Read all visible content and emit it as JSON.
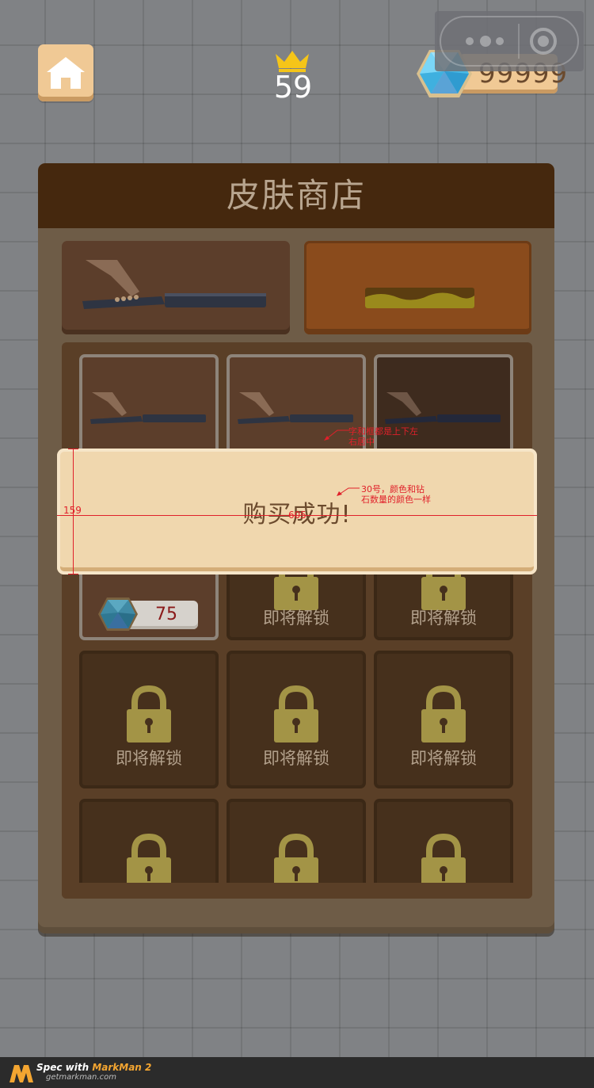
{
  "topbar": {
    "home_icon": "home-icon",
    "level_value": "59",
    "level_icon": "crown-icon",
    "coin_count": "99999",
    "coin_icon": "diamond-icon"
  },
  "miniprogram_capsule": {
    "more_icon": "more-dots-icon",
    "close_icon": "target-close-icon"
  },
  "shop": {
    "title": "皮肤商店",
    "items": [
      {
        "state": "owned",
        "variant": "green-bar"
      },
      {
        "state": "owned",
        "variant": "red-bar"
      },
      {
        "state": "owned-dark",
        "variant": "teal-bar"
      },
      {
        "state": "price",
        "price": "75",
        "price_icon": "diamond-icon"
      },
      {
        "state": "locked",
        "label": "即将解锁"
      },
      {
        "state": "locked",
        "label": "即将解锁"
      },
      {
        "state": "locked",
        "label": "即将解锁"
      },
      {
        "state": "locked",
        "label": "即将解锁"
      },
      {
        "state": "locked",
        "label": "即将解锁"
      },
      {
        "state": "locked"
      },
      {
        "state": "locked"
      },
      {
        "state": "locked"
      }
    ]
  },
  "toast": {
    "message": "购买成功!"
  },
  "annotations": {
    "note_center": "字和框都是上下左右居中",
    "note_font": "30号，颜色和钻石数量的颜色一样",
    "height_value": "159",
    "width_value": "605"
  },
  "footer": {
    "spec_prefix": "Spec with ",
    "brand": "MarkMan 2",
    "url": "getmarkman.com"
  },
  "colors": {
    "accent_text": "#6b4a2d",
    "toast_bg": "#f0d7ae",
    "header_bg": "#45280e",
    "lock_color": "#a39446",
    "annotation": "#e0202a"
  }
}
